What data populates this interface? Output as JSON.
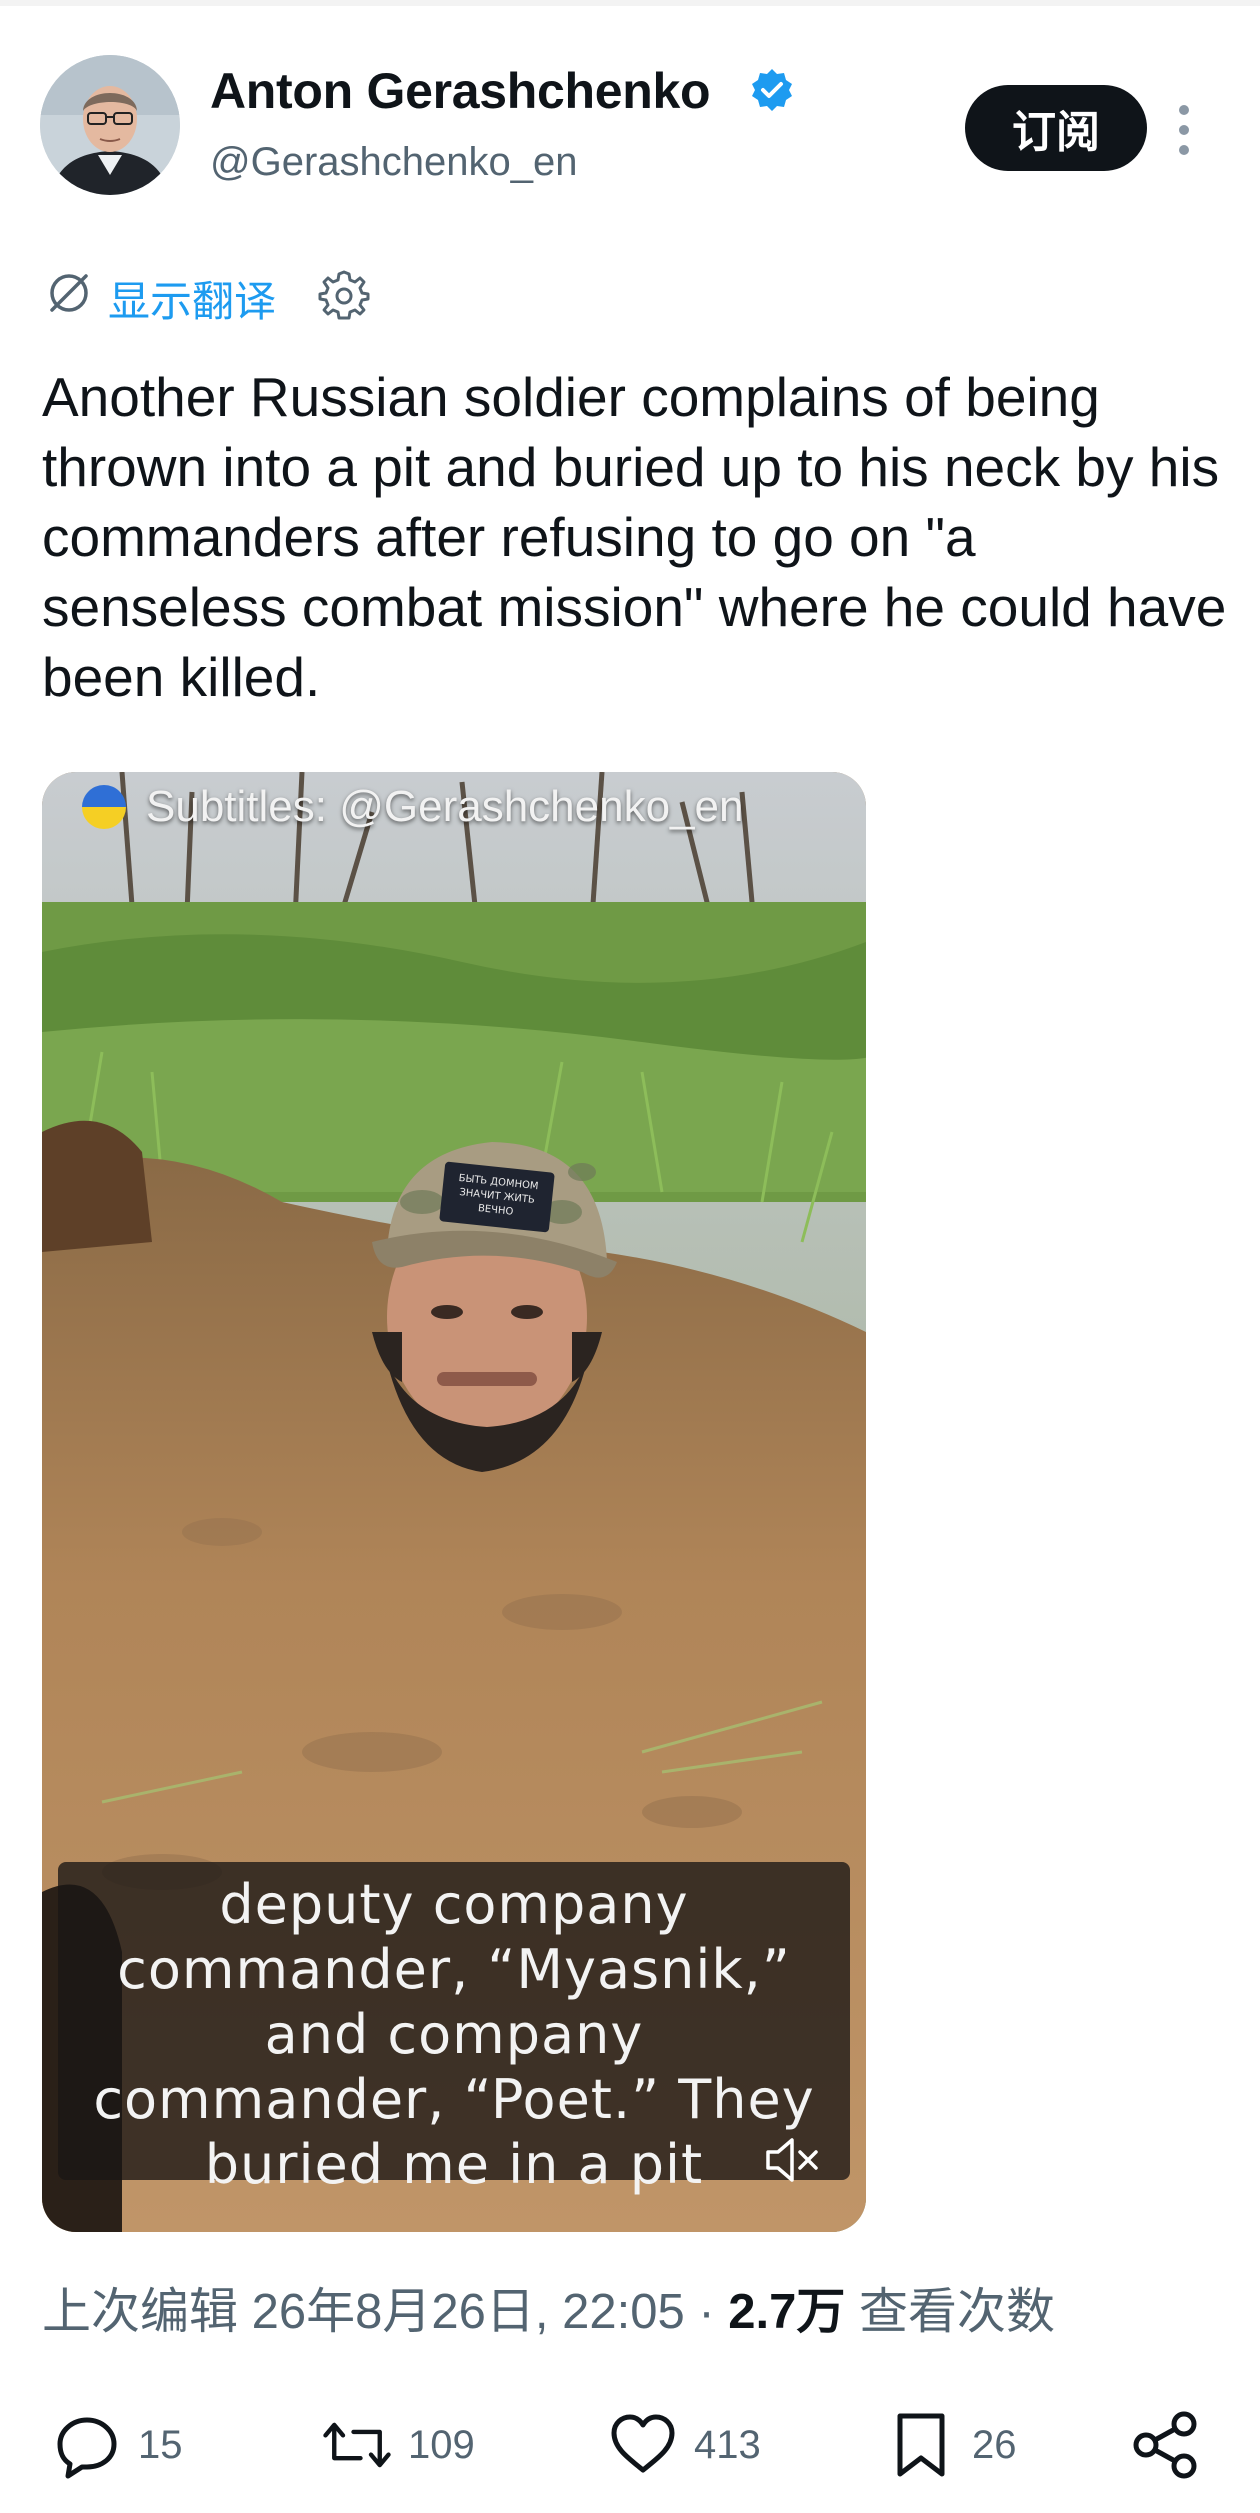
{
  "author": {
    "name": "Anton Gerashchenko",
    "handle": "@Gerashchenko_en",
    "verified": true
  },
  "header": {
    "subscribe_label": "订阅",
    "more_icon": "more-vertical-icon"
  },
  "translate": {
    "label": "显示翻译",
    "icon": "translate-icon",
    "settings_icon": "gear-icon"
  },
  "tweet": {
    "text": "Another Russian soldier complains of being thrown into a pit and buried up to his neck by his commanders after refusing to go on \"a senseless combat mission\" where he could have been killed."
  },
  "media": {
    "subtitle_credit": "Subtitles: @Gerashchenko_en",
    "caption": "deputy company\ncommander, “Myasnik,”\nand company\ncommander, “Poet.” They\nburied me in a pit",
    "cap_patch": "БЫТЬ ДОМНОМ\nЗНАЧИТ ЖИТЬ\nВЕЧНО",
    "mute_icon": "volume-muted-icon"
  },
  "meta": {
    "edited": "上次编辑 26年8月26日, 22:05",
    "separator": "·",
    "views": "2.7万",
    "views_label": "查看次数"
  },
  "actions": {
    "replies": "15",
    "retweets": "109",
    "likes": "413",
    "bookmarks": "26"
  },
  "colors": {
    "accent": "#1d9bf0",
    "text": "#0f1419",
    "secondary": "#536471"
  }
}
